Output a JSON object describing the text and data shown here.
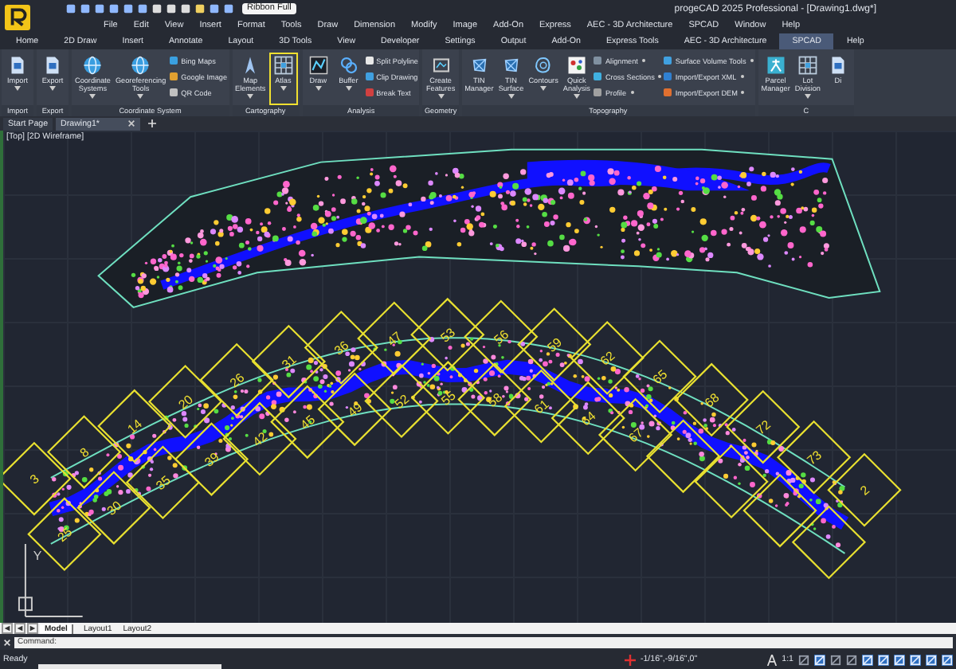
{
  "app": {
    "title": "progeCAD 2025 Professional - [Drawing1.dwg*]",
    "workspace": "Ribbon Full"
  },
  "menu": [
    "File",
    "Edit",
    "View",
    "Insert",
    "Format",
    "Tools",
    "Draw",
    "Dimension",
    "Modify",
    "Image",
    "Add-On",
    "Express",
    "AEC - 3D Architecture",
    "SPCAD",
    "Window",
    "Help"
  ],
  "ribbon_tabs": [
    {
      "label": "Home",
      "selected": false
    },
    {
      "label": "2D Draw",
      "selected": false
    },
    {
      "label": "Insert",
      "selected": false
    },
    {
      "label": "Annotate",
      "selected": false
    },
    {
      "label": "Layout",
      "selected": false
    },
    {
      "label": "3D Tools",
      "selected": false
    },
    {
      "label": "View",
      "selected": false
    },
    {
      "label": "Developer",
      "selected": false
    },
    {
      "label": "Settings",
      "selected": false
    },
    {
      "label": "Output",
      "selected": false
    },
    {
      "label": "Add-On",
      "selected": false
    },
    {
      "label": "Express Tools",
      "selected": false
    },
    {
      "label": "AEC - 3D Architecture",
      "selected": false
    },
    {
      "label": "SPCAD",
      "selected": true
    },
    {
      "label": "Help",
      "selected": false
    }
  ],
  "ribbon_groups": [
    {
      "label": "Import",
      "tools": [
        {
          "label": "Import",
          "kind": "large",
          "dropdown": true,
          "selected": false
        }
      ]
    },
    {
      "label": "Export",
      "tools": [
        {
          "label": "Export",
          "kind": "large",
          "dropdown": true,
          "selected": false
        }
      ]
    },
    {
      "label": "Coordinate System",
      "tools": [
        {
          "label": "Coordinate Systems",
          "kind": "large",
          "dropdown": true,
          "selected": false
        },
        {
          "label": "Georeferencing Tools",
          "kind": "large",
          "dropdown": true,
          "selected": false
        },
        {
          "label": "Bing Maps",
          "kind": "small",
          "dropdown": false,
          "selected": false
        },
        {
          "label": "Google Image",
          "kind": "small",
          "dropdown": false,
          "selected": false
        },
        {
          "label": "QR Code",
          "kind": "small",
          "dropdown": false,
          "selected": false
        }
      ]
    },
    {
      "label": "Cartography",
      "tools": [
        {
          "label": "Map Elements",
          "kind": "large",
          "dropdown": true,
          "selected": false
        },
        {
          "label": "Atlas",
          "kind": "large",
          "dropdown": true,
          "selected": true
        }
      ]
    },
    {
      "label": "Analysis",
      "tools": [
        {
          "label": "Draw",
          "kind": "large",
          "dropdown": true,
          "selected": false
        },
        {
          "label": "Buffer",
          "kind": "large",
          "dropdown": true,
          "selected": false
        },
        {
          "label": "Split Polyline",
          "kind": "small",
          "dropdown": false,
          "selected": false
        },
        {
          "label": "Clip Drawing",
          "kind": "small",
          "dropdown": false,
          "selected": false
        },
        {
          "label": "Break Text",
          "kind": "small",
          "dropdown": false,
          "selected": false
        }
      ]
    },
    {
      "label": "Geometry",
      "tools": [
        {
          "label": "Create Features",
          "kind": "large",
          "dropdown": true,
          "selected": false
        }
      ]
    },
    {
      "label": "Topography",
      "tools": [
        {
          "label": "TIN Manager",
          "kind": "large",
          "dropdown": false,
          "selected": false
        },
        {
          "label": "TIN Surface",
          "kind": "large",
          "dropdown": true,
          "selected": false
        },
        {
          "label": "Contours",
          "kind": "large",
          "dropdown": true,
          "selected": false
        },
        {
          "label": "Quick Analysis",
          "kind": "large",
          "dropdown": true,
          "selected": false
        },
        {
          "label": "Alignment",
          "kind": "small",
          "dropdown": true,
          "selected": false
        },
        {
          "label": "Cross Sections",
          "kind": "small",
          "dropdown": true,
          "selected": false
        },
        {
          "label": "Profile",
          "kind": "small",
          "dropdown": true,
          "selected": false
        },
        {
          "label": "Surface Volume Tools",
          "kind": "small",
          "dropdown": true,
          "selected": false
        },
        {
          "label": "Import/Export XML",
          "kind": "small",
          "dropdown": true,
          "selected": false
        },
        {
          "label": "Import/Export DEM",
          "kind": "small",
          "dropdown": true,
          "selected": false
        }
      ]
    },
    {
      "label": "C",
      "tools": [
        {
          "label": "Parcel Manager",
          "kind": "large",
          "dropdown": false,
          "selected": false
        },
        {
          "label": "Lot Division",
          "kind": "large",
          "dropdown": true,
          "selected": false
        },
        {
          "label": "Di",
          "kind": "large",
          "dropdown": false,
          "selected": false
        }
      ]
    }
  ],
  "doc_tabs": [
    {
      "label": "Start Page",
      "selected": false
    },
    {
      "label": "Drawing1*",
      "selected": true
    }
  ],
  "viewport": {
    "label": "[Top] [2D Wireframe]",
    "ucs_label": "Y",
    "tile_labels": [
      "3",
      "8",
      "14",
      "20",
      "26",
      "31",
      "36",
      "47",
      "53",
      "56",
      "59",
      "62",
      "65",
      "68",
      "72",
      "73",
      "2",
      "25",
      "30",
      "35",
      "39",
      "42",
      "45",
      "49",
      "52",
      "55",
      "58",
      "61",
      "64",
      "67"
    ]
  },
  "layout_tabs": [
    {
      "label": "Model",
      "kind": "model",
      "selected": true
    },
    {
      "label": "Layout1",
      "kind": "layout",
      "selected": false
    },
    {
      "label": "Layout2",
      "kind": "layout",
      "selected": false
    }
  ],
  "command": {
    "prompt": "Command:"
  },
  "status": {
    "state": "Ready",
    "coordinates": "-1/16\",-9/16\",0\"",
    "scale": "1:1"
  }
}
